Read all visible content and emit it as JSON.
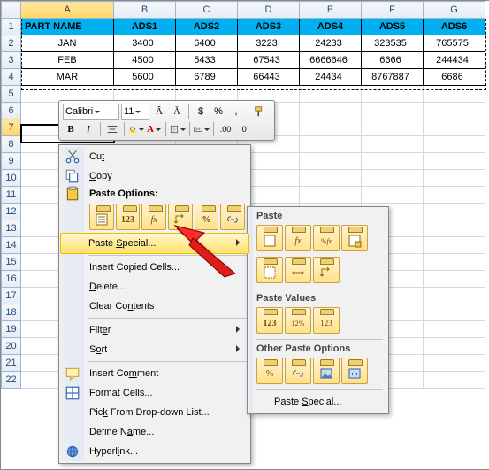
{
  "columns": [
    "A",
    "B",
    "C",
    "D",
    "E",
    "F",
    "G"
  ],
  "rows": [
    "1",
    "2",
    "3",
    "4",
    "5",
    "6",
    "7",
    "8",
    "9",
    "10",
    "11",
    "12",
    "13",
    "14",
    "15",
    "16",
    "17",
    "18",
    "19",
    "20",
    "21",
    "22"
  ],
  "header": {
    "A": "PART NAME",
    "B": "ADS1",
    "C": "ADS2",
    "D": "ADS3",
    "E": "ADS4",
    "F": "ADS5",
    "G": "ADS6"
  },
  "data": [
    {
      "A": "JAN",
      "B": "3400",
      "C": "6400",
      "D": "3223",
      "E": "24233",
      "F": "323535",
      "G": "765575"
    },
    {
      "A": "FEB",
      "B": "4500",
      "C": "5433",
      "D": "67543",
      "E": "6666646",
      "F": "6666",
      "G": "244434"
    },
    {
      "A": "MAR",
      "B": "5600",
      "C": "6789",
      "D": "66443",
      "E": "24434",
      "F": "8767887",
      "G": "6686"
    }
  ],
  "mini": {
    "font": "Calibri",
    "size": "11",
    "bold": "B",
    "italic": "I"
  },
  "ctx": {
    "cut": "Cut",
    "copy": "Copy",
    "paste_options": "Paste Options:",
    "paste_special": "Paste Special...",
    "insert": "Insert Copied Cells...",
    "delete": "Delete...",
    "clear": "Clear Contents",
    "filter": "Filter",
    "sort": "Sort",
    "comment": "Insert Comment",
    "format": "Format Cells...",
    "picklist": "Pick From Drop-down List...",
    "define": "Define Name...",
    "hyperlink": "Hyperlink..."
  },
  "sub": {
    "paste": "Paste",
    "paste_values": "Paste Values",
    "other": "Other Paste Options",
    "paste_special": "Paste Special..."
  },
  "opts": {
    "all": "",
    "values": "123",
    "formulas": "fx",
    "transpose": "",
    "percent": "%",
    "link": ""
  }
}
